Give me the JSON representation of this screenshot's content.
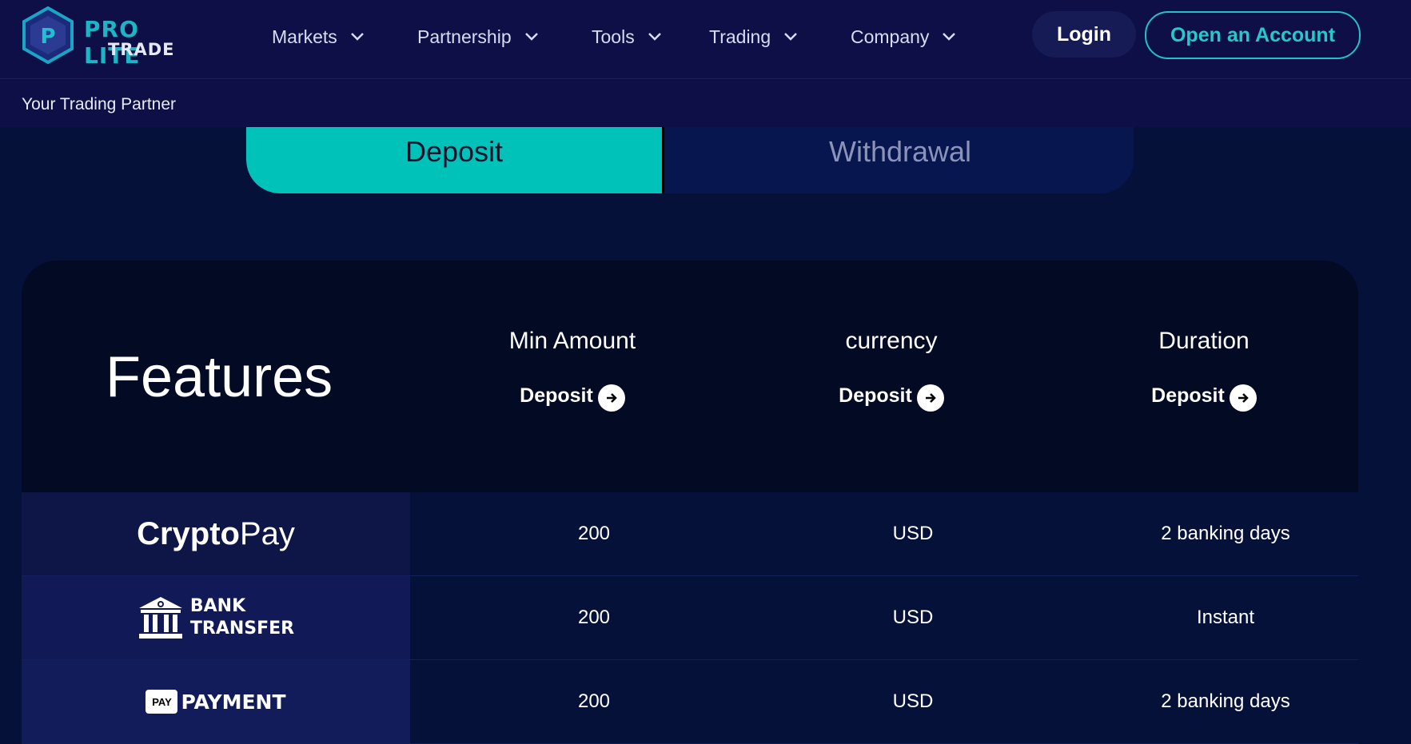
{
  "brand": {
    "line1": "PRO LITE",
    "line2": "TRADE"
  },
  "nav": [
    {
      "label": "Markets"
    },
    {
      "label": "Partnership"
    },
    {
      "label": "Tools"
    },
    {
      "label": "Trading"
    },
    {
      "label": "Company"
    }
  ],
  "header": {
    "login_label": "Login",
    "open_account_label": "Open an Account"
  },
  "tagline": "Your Trading Partner",
  "tabs": {
    "deposit": "Deposit",
    "withdrawal": "Withdrawal",
    "active": "Deposit"
  },
  "features": {
    "title": "Features",
    "columns": [
      {
        "label": "Min Amount",
        "action": "Deposit"
      },
      {
        "label": "currency",
        "action": "Deposit"
      },
      {
        "label": "Duration",
        "action": "Deposit"
      }
    ]
  },
  "rows": [
    {
      "method": "CryptoPay",
      "method_bold": "Crypto",
      "method_light": "Pay",
      "min": "200",
      "currency": "USD",
      "duration": "2 banking days"
    },
    {
      "method": "BANK TRANSFER",
      "line1": "BANK",
      "line2": "TRANSFER",
      "min": "200",
      "currency": "USD",
      "duration": "Instant"
    },
    {
      "method": "PAYMENT",
      "badge": "PAY",
      "label": "PAYMENT",
      "min": "200",
      "currency": "USD",
      "duration": "2 banking days"
    }
  ],
  "colors": {
    "accent": "#00c2b8",
    "header_bg": "#0d0f46",
    "page_bg": "#06113a",
    "card_bg": "#030a24"
  }
}
